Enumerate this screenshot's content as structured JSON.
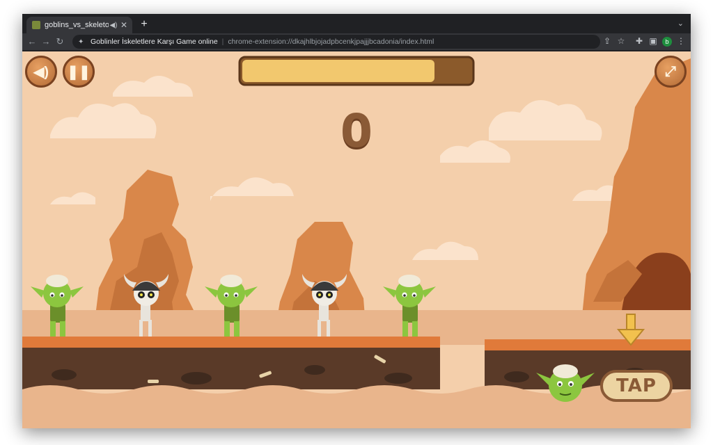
{
  "browser": {
    "tab_title": "goblins_vs_skeletons",
    "tab_audio_icon": "speaker-icon",
    "tab_close_icon": "close-icon",
    "new_tab_icon": "plus-icon",
    "page_title": "Goblinler İskeletlere Karşı Game online",
    "url": "chrome-extension://dkajhlbjojadpbcenkjpajjjbcadonia/index.html",
    "profile_initial": "b"
  },
  "game": {
    "score": "0",
    "time_bar_fill": 0.84,
    "tap_label": "TAP",
    "buttons": {
      "sound_icon": "speaker-icon",
      "pause_icon": "pause-icon",
      "fullscreen_icon": "fullscreen-icon"
    },
    "colors": {
      "sky": "#f4cfab",
      "ground": "#e07a3a",
      "bar_fill": "#f2c86e",
      "bar_track": "#8b5a2b",
      "goblin": "#8cc63f",
      "ui_brown": "#8a5a36"
    },
    "characters_on_platform": [
      "goblin",
      "skeleton",
      "goblin",
      "skeleton",
      "goblin"
    ],
    "next_character": "goblin"
  }
}
